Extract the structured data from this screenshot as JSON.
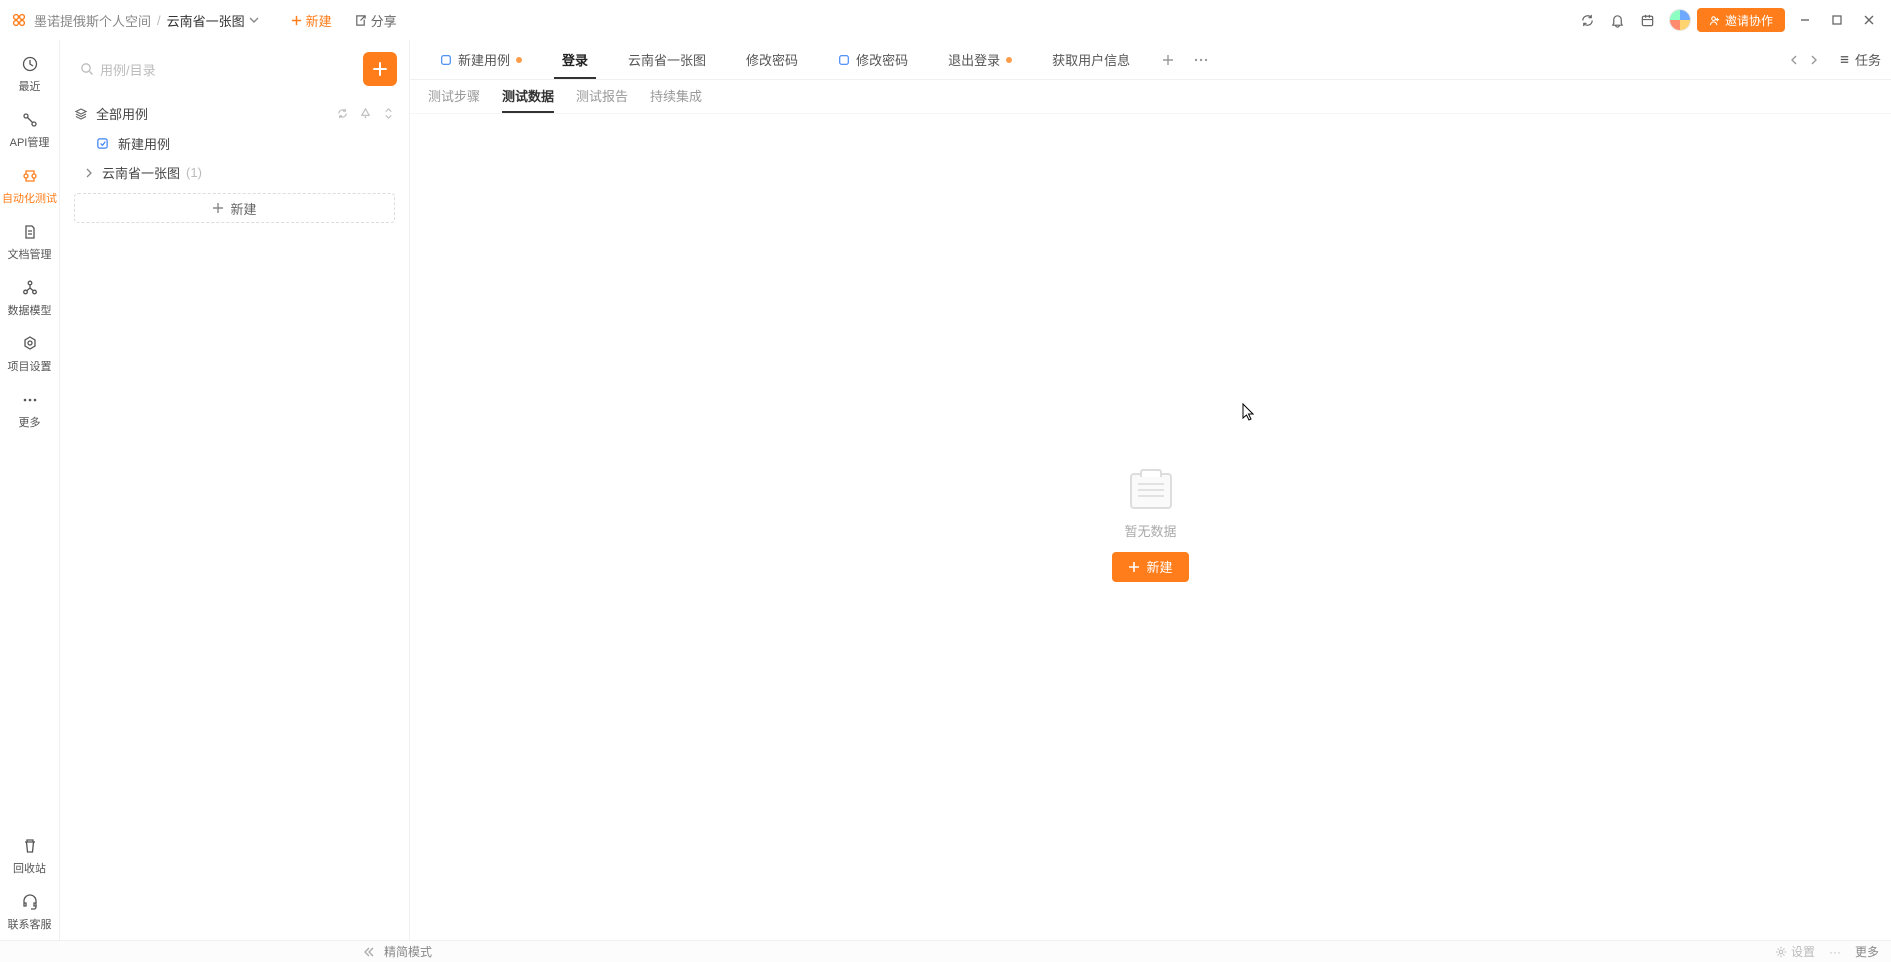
{
  "header": {
    "workspace": "墨诺提俄斯个人空间",
    "project": "云南省一张图",
    "new_label": "新建",
    "share_label": "分享",
    "invite_label": "邀请协作"
  },
  "rail": {
    "recent": "最近",
    "api": "API管理",
    "autotest": "自动化测试",
    "docs": "文档管理",
    "schema": "数据模型",
    "settings": "项目设置",
    "more": "更多",
    "trash": "回收站",
    "support": "联系客服"
  },
  "sidebar": {
    "search_placeholder": "用例/目录",
    "all_cases": "全部用例",
    "new_case": "新建用例",
    "folder1": "云南省一张图",
    "folder1_count": "(1)",
    "new_btn": "新建"
  },
  "tabs": {
    "t0": "新建用例",
    "t1": "登录",
    "t2": "云南省一张图",
    "t3": "修改密码",
    "t4": "修改密码",
    "t5": "退出登录",
    "t6": "获取用户信息",
    "tasks": "任务"
  },
  "subtabs": {
    "s0": "测试步骤",
    "s1": "测试数据",
    "s2": "测试报告",
    "s3": "持续集成"
  },
  "empty": {
    "text": "暂无数据",
    "btn": "新建"
  },
  "footer": {
    "mode": "精简模式",
    "settings": "设置",
    "more": "更多"
  }
}
